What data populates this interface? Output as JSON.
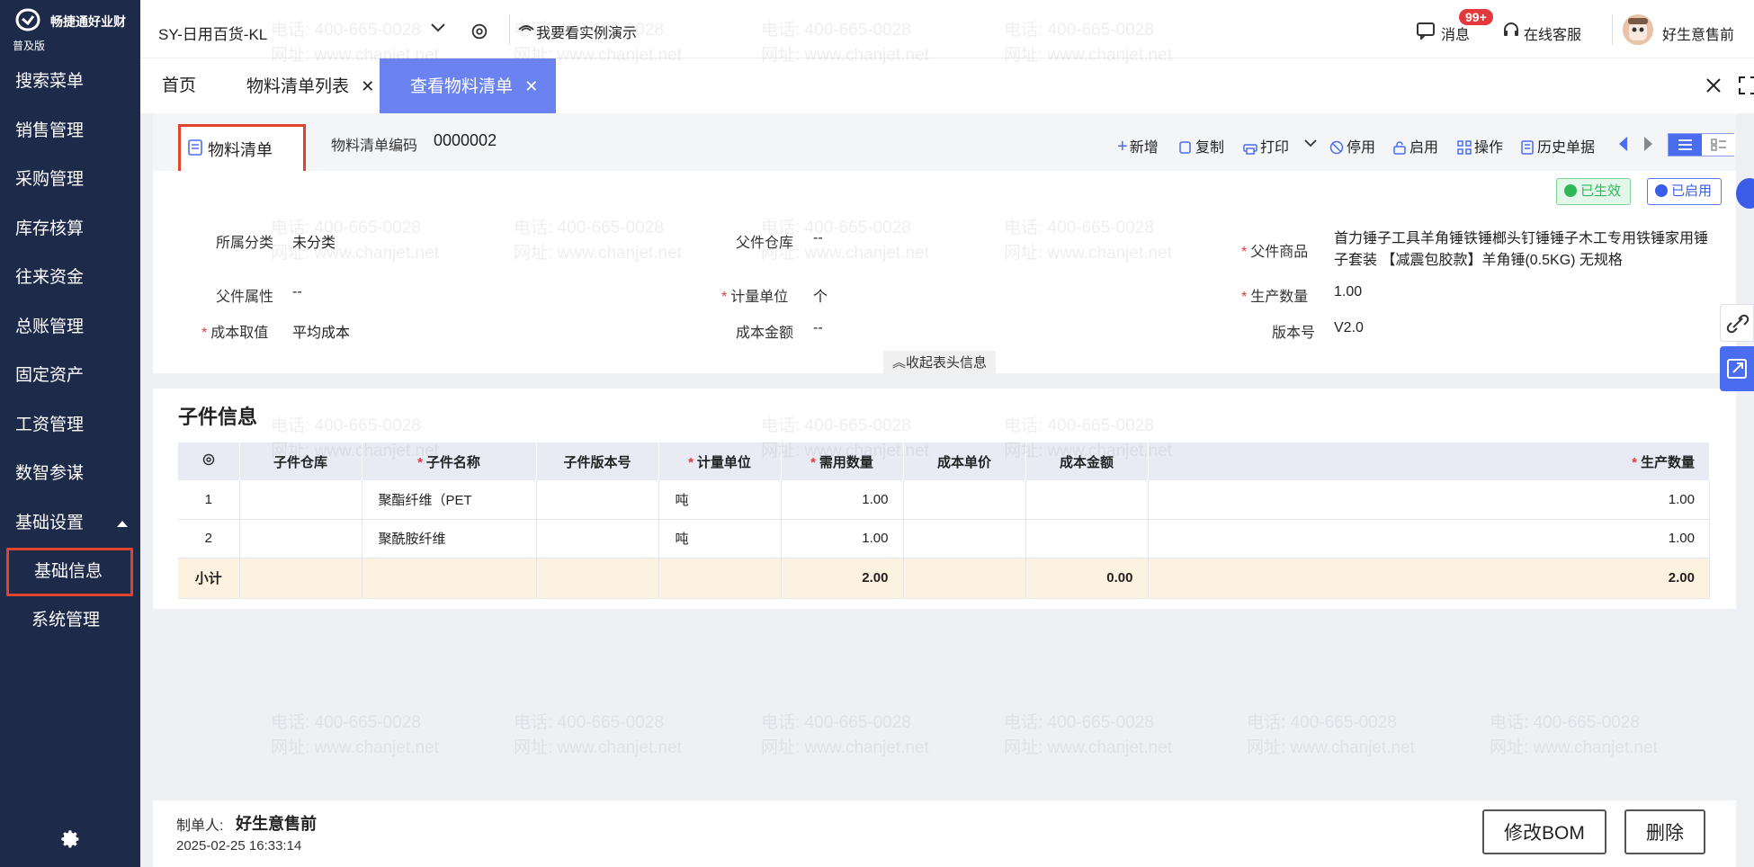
{
  "app": {
    "brand": "畅捷通好业财",
    "edition": "普及版"
  },
  "sidebar": {
    "items": [
      {
        "label": "搜索菜单"
      },
      {
        "label": "销售管理"
      },
      {
        "label": "采购管理"
      },
      {
        "label": "库存核算"
      },
      {
        "label": "往来资金"
      },
      {
        "label": "总账管理"
      },
      {
        "label": "固定资产"
      },
      {
        "label": "工资管理"
      },
      {
        "label": "数智参谋"
      },
      {
        "label": "基础设置"
      }
    ],
    "sub_items": [
      {
        "label": "基础信息",
        "active": true
      },
      {
        "label": "系统管理"
      }
    ]
  },
  "topbar": {
    "account": "SY-日用百货-KL",
    "demo": "我要看实例演示",
    "messages": "消息",
    "badge": "99+",
    "support": "在线客服",
    "user": "好生意售前"
  },
  "tabs": [
    {
      "label": "首页"
    },
    {
      "label": "物料清单列表"
    },
    {
      "label": "查看物料清单"
    }
  ],
  "doc": {
    "type": "物料清单",
    "code_label": "物料清单编码",
    "code": "0000002",
    "tools": {
      "add": "新增",
      "copy": "复制",
      "print": "打印",
      "disable": "停用",
      "enable": "启用",
      "ops": "操作",
      "history": "历史单据"
    },
    "status_effective": "已生效",
    "status_enabled": "已启用"
  },
  "form": {
    "category_label": "所属分类",
    "category": "未分类",
    "parent_wh_label": "父件仓库",
    "parent_wh": "--",
    "parent_item_label": "父件商品",
    "parent_item": "首力锤子工具羊角锤铁锤榔头钉锤锤子木工专用铁锤家用锤子套装 【减震包胶款】羊角锤(0.5KG) 无规格",
    "parent_attr_label": "父件属性",
    "parent_attr": "--",
    "unit_label": "计量单位",
    "unit": "个",
    "qty_label": "生产数量",
    "qty": "1.00",
    "cost_method_label": "成本取值",
    "cost_method": "平均成本",
    "cost_amount_label": "成本金额",
    "cost_amount": "--",
    "version_label": "版本号",
    "version": "V2.0",
    "collapse": "收起表头信息"
  },
  "children": {
    "title": "子件信息",
    "headers": {
      "wh": "子件仓库",
      "name": "子件名称",
      "ver": "子件版本号",
      "unit": "计量单位",
      "need": "需用数量",
      "price": "成本单价",
      "amount": "成本金额",
      "prod": "生产数量"
    },
    "rows": [
      {
        "idx": "1",
        "wh": "",
        "name": "聚酯纤维（PET",
        "ver": "",
        "unit": "吨",
        "need": "1.00",
        "price": "",
        "amount": "",
        "prod": "1.00"
      },
      {
        "idx": "2",
        "wh": "",
        "name": "聚酰胺纤维",
        "ver": "",
        "unit": "吨",
        "need": "1.00",
        "price": "",
        "amount": "",
        "prod": "1.00"
      }
    ],
    "subtotal": {
      "label": "小计",
      "need": "2.00",
      "amount": "0.00",
      "prod": "2.00"
    }
  },
  "footer": {
    "creator_label": "制单人:",
    "creator": "好生意售前",
    "created": "2025-02-25 16:33:14",
    "edit_btn": "修改BOM",
    "delete_btn": "删除"
  },
  "watermark": {
    "phone": "电话: 400-665-0028",
    "site": "网址: www.chanjet.net"
  }
}
